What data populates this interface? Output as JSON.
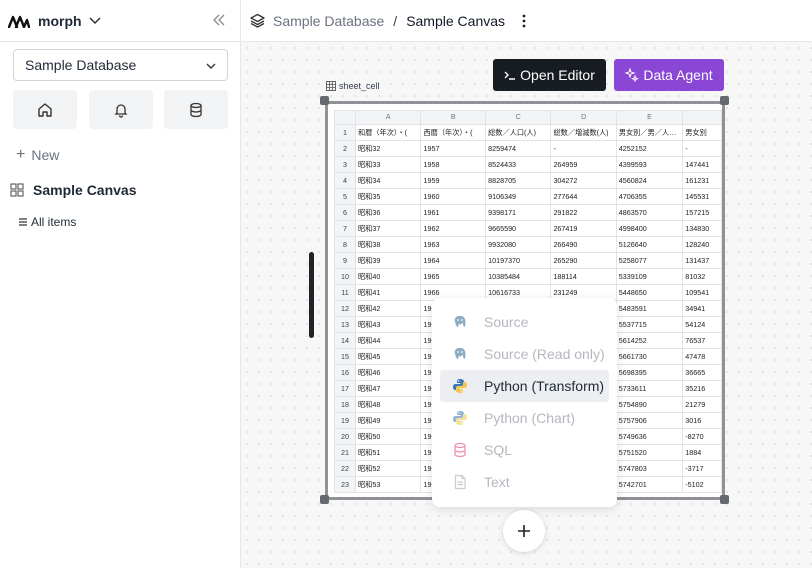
{
  "sidebar": {
    "brand": "morph",
    "database_select": "Sample Database",
    "new_label": "New",
    "canvas_item": "Sample Canvas",
    "all_items": "All items"
  },
  "topbar": {
    "database": "Sample Database",
    "separator": "/",
    "canvas": "Sample Canvas"
  },
  "canvas": {
    "open_editor": "Open Editor",
    "data_agent": "Data Agent",
    "cell_name": "sheet_cell"
  },
  "sheet": {
    "columns": [
      "A",
      "B",
      "C",
      "D",
      "E",
      ""
    ],
    "rows": [
      [
        "1",
        "和暦（年次）・(",
        "西暦（年次）・(",
        "総数／人口(人)",
        "総数／増減数(人)",
        "男女別／男／人…",
        "男女別"
      ],
      [
        "2",
        "昭和32",
        "1957",
        "8259474",
        "-",
        "4252152",
        "-"
      ],
      [
        "3",
        "昭和33",
        "1958",
        "8524433",
        "264959",
        "4399593",
        "147441"
      ],
      [
        "4",
        "昭和34",
        "1959",
        "8828705",
        "304272",
        "4560824",
        "161231"
      ],
      [
        "5",
        "昭和35",
        "1960",
        "9106349",
        "277644",
        "4706355",
        "145531"
      ],
      [
        "6",
        "昭和36",
        "1961",
        "9398171",
        "291822",
        "4863570",
        "157215"
      ],
      [
        "7",
        "昭和37",
        "1962",
        "9665590",
        "267419",
        "4998400",
        "134830"
      ],
      [
        "8",
        "昭和38",
        "1963",
        "9932080",
        "266490",
        "5126640",
        "128240"
      ],
      [
        "9",
        "昭和39",
        "1964",
        "10197370",
        "265290",
        "5258077",
        "131437"
      ],
      [
        "10",
        "昭和40",
        "1965",
        "10385484",
        "188114",
        "5339109",
        "81032"
      ],
      [
        "11",
        "昭和41",
        "1966",
        "10616733",
        "231249",
        "5448650",
        "109541"
      ],
      [
        "12",
        "昭和42",
        "19",
        "",
        "",
        "5483591",
        "34941"
      ],
      [
        "13",
        "昭和43",
        "19",
        "",
        "",
        "5537715",
        "54124"
      ],
      [
        "14",
        "昭和44",
        "19",
        "",
        "",
        "5614252",
        "76537"
      ],
      [
        "15",
        "昭和45",
        "19",
        "",
        "",
        "5661730",
        "47478"
      ],
      [
        "16",
        "昭和46",
        "19",
        "",
        "",
        "5698395",
        "36665"
      ],
      [
        "17",
        "昭和47",
        "19",
        "",
        "",
        "5733611",
        "35216"
      ],
      [
        "18",
        "昭和48",
        "19",
        "",
        "",
        "5754890",
        "21279"
      ],
      [
        "19",
        "昭和49",
        "19",
        "",
        "",
        "5757906",
        "3016"
      ],
      [
        "20",
        "昭和50",
        "19",
        "",
        "",
        "5749636",
        "-8270"
      ],
      [
        "21",
        "昭和51",
        "19",
        "",
        "",
        "5751520",
        "1884"
      ],
      [
        "22",
        "昭和52",
        "19",
        "",
        "",
        "5747803",
        "-3717"
      ],
      [
        "23",
        "昭和53",
        "19",
        "",
        "",
        "5742701",
        "-5102"
      ]
    ]
  },
  "menu": {
    "items": [
      {
        "label": "Source",
        "icon": "postgres-icon",
        "active": false
      },
      {
        "label": "Source (Read only)",
        "icon": "postgres-icon",
        "active": false
      },
      {
        "label": "Python (Transform)",
        "icon": "python-icon",
        "active": true
      },
      {
        "label": "Python (Chart)",
        "icon": "python-icon",
        "active": false
      },
      {
        "label": "SQL",
        "icon": "database-icon",
        "active": false
      },
      {
        "label": "Text",
        "icon": "document-icon",
        "active": false
      }
    ]
  }
}
